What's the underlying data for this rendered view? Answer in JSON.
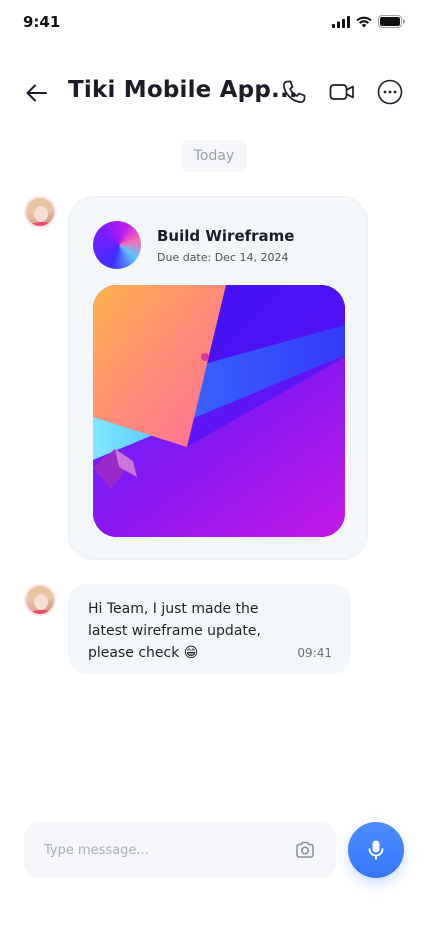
{
  "status_bar": {
    "time": "9:41"
  },
  "header": {
    "title": "Tiki Mobile App..."
  },
  "date_divider": "Today",
  "task_message": {
    "title": "Build Wireframe",
    "due": "Due date: Dec 14, 2024"
  },
  "text_message": {
    "text": "Hi Team, I just made the latest wireframe update, please check 😁",
    "time": "09:41"
  },
  "composer": {
    "placeholder": "Type message..."
  },
  "colors": {
    "accent": "#3578f6",
    "bubble": "#f4f7fa",
    "text": "#1f1f29"
  },
  "icons": {
    "back": "arrow-left-icon",
    "call": "phone-icon",
    "video": "video-camera-icon",
    "more": "more-dots-icon",
    "camera": "camera-icon",
    "mic": "microphone-icon"
  }
}
